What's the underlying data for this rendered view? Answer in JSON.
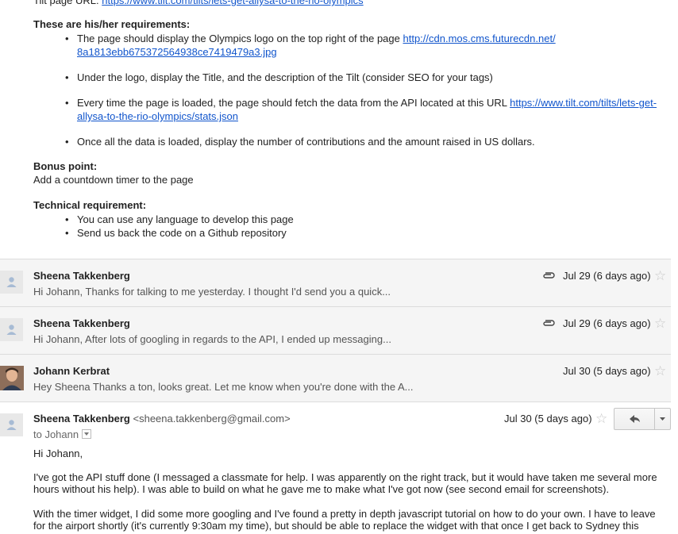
{
  "message_top": {
    "tilt_page_prefix": "Tilt page URL: ",
    "tilt_page_url": "https://www.tilt.com/tilts/lets-get-allysa-to-the-rio-olympics",
    "requirements_title": "These are his/her requirements:",
    "requirements": [
      {
        "text": "The page should display the Olympics logo on the top right of the page ",
        "link_line1": "http://cdn.mos.cms.futurecdn.net/",
        "link_line2": "8a1813ebb675372564938ce7419479a3.jpg"
      },
      {
        "text": "Under the logo, display the Title, and the description of the Tilt (consider SEO for your tags)"
      },
      {
        "text": "Every time the page is loaded, the page should fetch the data from the API located at this URL ",
        "link_line1": "https://www.tilt.com/tilts/lets-get-",
        "link_line2": "allysa-to-the-rio-olympics/stats.json"
      },
      {
        "text": "Once all the data is loaded, display the number of contributions and the amount raised in US dollars."
      }
    ],
    "bonus_title": "Bonus point:",
    "bonus_text": "Add a countdown timer to the page",
    "technical_title": "Technical requirement:",
    "technical": [
      "You can use any language to develop this page",
      "Send us back the code on a Github repository"
    ]
  },
  "threads": [
    {
      "sender": "Sheena Takkenberg",
      "snippet": "Hi Johann, Thanks for talking to me yesterday. I thought I'd send you a quick...",
      "date": "Jul 29 (6 days ago)",
      "attachment": true,
      "avatar": "default-avatar-icon"
    },
    {
      "sender": "Sheena Takkenberg",
      "snippet": "Hi Johann, After lots of googling in regards to the API, I ended up messaging...",
      "date": "Jul 29 (6 days ago)",
      "attachment": true,
      "avatar": "default-avatar-icon"
    },
    {
      "sender": "Johann Kerbrat",
      "snippet": "Hey Sheena Thanks a ton, looks great. Let me know when you're done with the A...",
      "date": "Jul 30 (5 days ago)",
      "attachment": false,
      "avatar": "profile-photo"
    }
  ],
  "expanded_message": {
    "sender": "Sheena Takkenberg",
    "email": "<sheena.takkenberg@gmail.com>",
    "to_label": "to Johann",
    "date": "Jul 30 (5 days ago)",
    "greeting": "Hi Johann,",
    "paragraph1": "I've got the API stuff done (I messaged a classmate for help. I was apparently on the right track, but it would have taken me several more hours without his help). I was able to build on what he gave me to make what I've got now (see second email for screenshots).",
    "paragraph2": "With the timer widget, I did some more googling and I've found a pretty in depth javascript tutorial on how to do your own. I have to leave for the airport shortly (it's currently 9:30am my time), but should be able to replace the widget with that once I get back to Sydney this"
  },
  "colors": {
    "link": "#1155cc",
    "thread_bg": "#f5f5f5",
    "star": "#c8c8c8"
  }
}
